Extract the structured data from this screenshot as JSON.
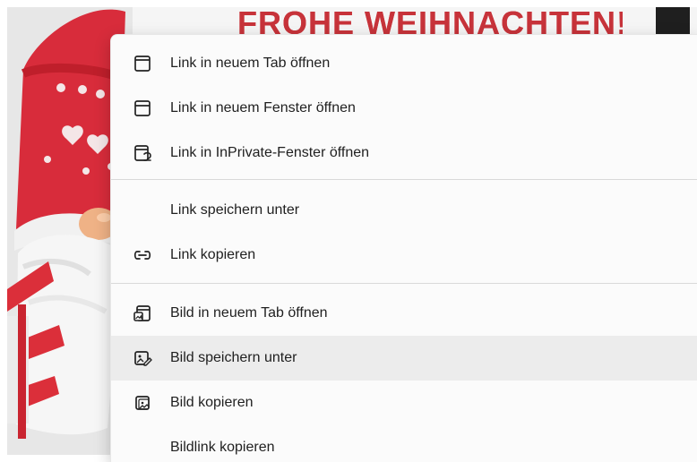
{
  "background": {
    "banner_text": "FROHE WEIHNACHTEN!"
  },
  "menu": {
    "items": [
      {
        "label": "Link in neuem Tab öffnen",
        "icon": "new-tab-icon"
      },
      {
        "label": "Link in neuem Fenster öffnen",
        "icon": "new-window-icon"
      },
      {
        "label": "Link in InPrivate-Fenster öffnen",
        "icon": "inprivate-window-icon"
      },
      {
        "label": "Link speichern unter",
        "icon": ""
      },
      {
        "label": "Link kopieren",
        "icon": "link-icon"
      },
      {
        "label": "Bild in neuem Tab öffnen",
        "icon": "image-new-tab-icon"
      },
      {
        "label": "Bild speichern unter",
        "icon": "image-save-icon"
      },
      {
        "label": "Bild kopieren",
        "icon": "image-copy-icon"
      },
      {
        "label": "Bildlink kopieren",
        "icon": ""
      }
    ]
  },
  "colors": {
    "menu_background": "#fbfbfb",
    "menu_selected": "#ececec",
    "divider": "#d9d9d9",
    "text": "#1f1f1f",
    "banner_red": "#c7333a"
  }
}
